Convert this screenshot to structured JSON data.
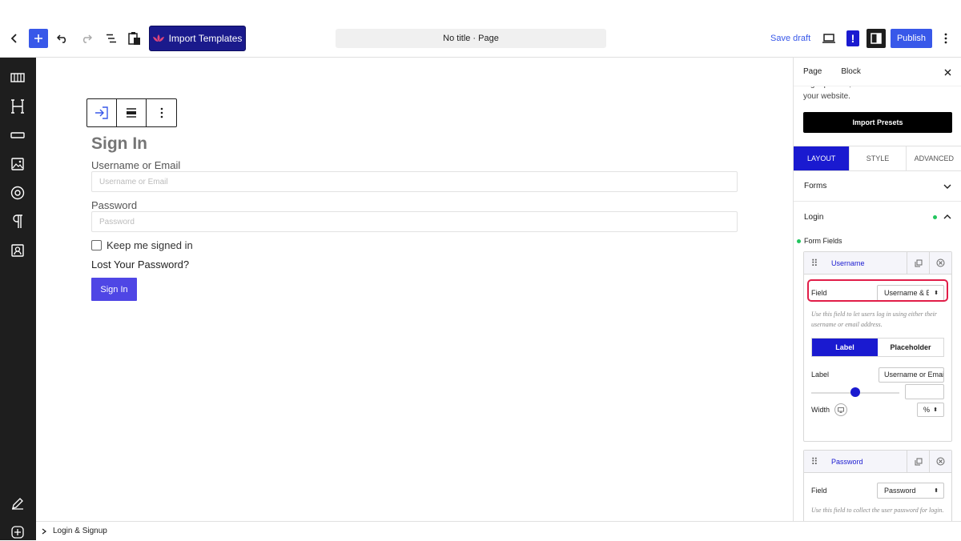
{
  "topbar": {
    "import_templates_label": "Import Templates",
    "doc_title": "No title · Page",
    "save_draft_label": "Save draft",
    "publish_label": "Publish",
    "notice_label": "!"
  },
  "canvas": {
    "form_title": "Sign In",
    "username_label": "Username or Email",
    "username_placeholder": "Username or Email",
    "password_label": "Password",
    "password_placeholder": "Password",
    "remember_label": "Keep me signed in",
    "lost_password_label": "Lost Your Password?",
    "submit_label": "Sign In"
  },
  "footer": {
    "breadcrumb": "Login & Signup"
  },
  "panel": {
    "tabs": [
      "Page",
      "Block"
    ],
    "description": "Signup Form, Password Reset Form for your website.",
    "import_presets_label": "Import Presets",
    "segments": [
      "LAYOUT",
      "STYLE",
      "ADVANCED"
    ],
    "active_segment": "LAYOUT",
    "forms_label": "Forms",
    "login_label": "Login",
    "form_fields_label": "Form Fields",
    "username_card": {
      "name": "Username",
      "field_label": "Field",
      "field_value": "Username & Email",
      "help": "Use this field to let users log in using either their username or email address.",
      "toggle": [
        "Label",
        "Placeholder"
      ],
      "label_label": "Label",
      "label_value": "Username or Email",
      "width_label": "Width",
      "width_unit": "%",
      "width_fraction": 0.5
    },
    "password_card": {
      "name": "Password",
      "field_label": "Field",
      "field_value": "Password",
      "help": "Use this field to collect the user password for login."
    },
    "accent_color": "#1a1ad0",
    "highlight_color": "#e11d48"
  }
}
